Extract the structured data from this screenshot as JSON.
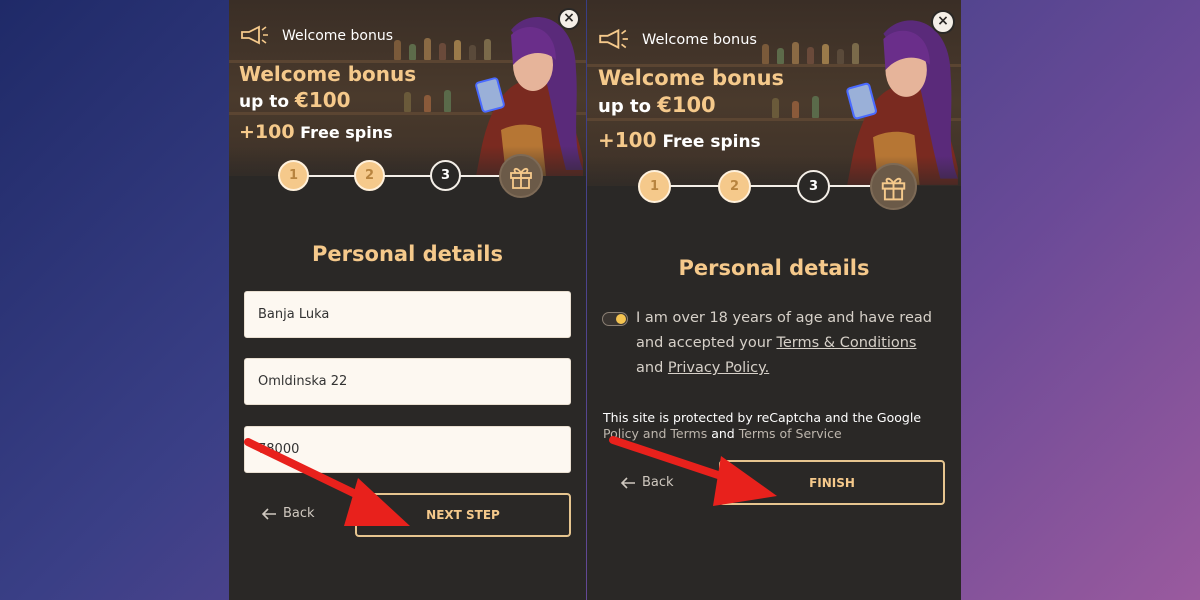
{
  "left_screen": {
    "banner": {
      "small_title": "Welcome bonus",
      "title": "Welcome bonus",
      "line2_prefix": "up to",
      "line2_amount": "€100",
      "line3_amount": "+100",
      "line3_text": "Free spins"
    },
    "close_label": "×",
    "steps": [
      "1",
      "2",
      "3"
    ],
    "heading": "Personal details",
    "fields": [
      {
        "value": "Banja Luka"
      },
      {
        "value": "Omldinska 22"
      },
      {
        "value": "78000"
      }
    ],
    "back_label": "Back",
    "primary_label": "NEXT STEP"
  },
  "right_screen": {
    "banner": {
      "small_title": "Welcome bonus",
      "title": "Welcome bonus",
      "line2_prefix": "up to",
      "line2_amount": "€100",
      "line3_amount": "+100",
      "line3_text": "Free spins"
    },
    "close_label": "×",
    "steps": [
      "1",
      "2",
      "3"
    ],
    "heading": "Personal details",
    "consent": {
      "part1": "I am over 18 years of age and have read and accepted your ",
      "terms_link": "Terms & Conditions",
      "and": " and ",
      "privacy_link": "Privacy Policy."
    },
    "captcha": {
      "line1": "This site is protected by reCaptcha and the Google",
      "policy": "Policy and Terms",
      "and": " and ",
      "terms": "Terms of Service"
    },
    "back_label": "Back",
    "primary_label": "FINISH"
  },
  "colors": {
    "accent_gold": "#f5c98b",
    "panel_bg": "#2a2826",
    "arrow_red": "#e8211c"
  }
}
